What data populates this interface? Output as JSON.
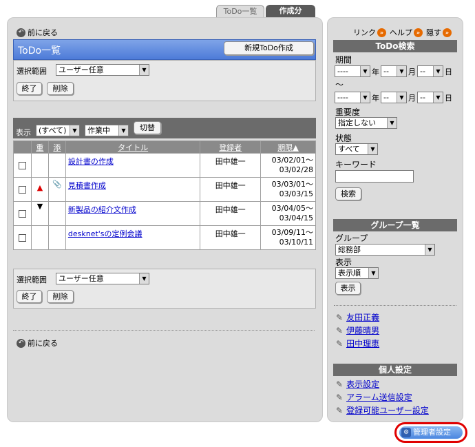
{
  "tabs": [
    {
      "label": "ToDo一覧"
    },
    {
      "label": "作成分"
    }
  ],
  "main": {
    "back_label": "前に戻る",
    "title": "ToDo一覧",
    "new_button": "新規ToDo作成",
    "range_label": "選択範囲",
    "range_value": "ユーザー任意",
    "finish_button": "終了",
    "delete_button": "削除",
    "display_label": "表示",
    "filter_all": "(すべて)",
    "filter_status": "作業中",
    "switch_button": "切替",
    "columns": {
      "importance": "重",
      "attach": "添",
      "title": "タイトル",
      "registrant": "登録者",
      "deadline": "期限▲"
    },
    "rows": [
      {
        "title": "設計書の作成",
        "registrant": "田中雄一",
        "start": "03/02/01～",
        "end": "03/02/28",
        "importance": "",
        "attach": ""
      },
      {
        "title": "見積書作成",
        "registrant": "田中雄一",
        "start": "03/03/01～",
        "end": "03/03/15",
        "importance": "▲",
        "attach": "📎"
      },
      {
        "title": "新製品の紹介文作成",
        "registrant": "田中雄一",
        "start": "03/04/05～",
        "end": "03/04/15",
        "importance": "▼",
        "attach": ""
      },
      {
        "title": "desknet'sの定例会議",
        "registrant": "田中雄一",
        "start": "03/09/11～",
        "end": "03/10/11",
        "importance": "",
        "attach": ""
      }
    ],
    "back_label_bottom": "前に戻る"
  },
  "side": {
    "links": {
      "link": "リンク",
      "help": "ヘルプ",
      "hide": "隠す"
    },
    "search": {
      "header": "ToDo検索",
      "period_label": "期間",
      "dash_value": "----",
      "dash_short": "--",
      "year": "年",
      "month": "月",
      "day": "日",
      "tilde": "～",
      "importance_label": "重要度",
      "importance_value": "指定しない",
      "status_label": "状態",
      "status_value": "すべて",
      "keyword_label": "キーワード",
      "search_button": "検索"
    },
    "group": {
      "header": "グループ一覧",
      "group_label": "グループ",
      "group_value": "総務部",
      "display_label": "表示",
      "display_value": "表示順",
      "display_button": "表示"
    },
    "users": [
      "友田正義",
      "伊藤晴男",
      "田中理恵"
    ],
    "personal": {
      "header": "個人設定",
      "items": [
        "表示設定",
        "アラーム送信設定",
        "登録可能ユーザー設定"
      ]
    }
  },
  "admin_label": "管理者設定",
  "colors": {
    "title_blue": "#4d7bd8",
    "header_gray": "#6b6b6b",
    "admin_ring": "#e00000"
  }
}
